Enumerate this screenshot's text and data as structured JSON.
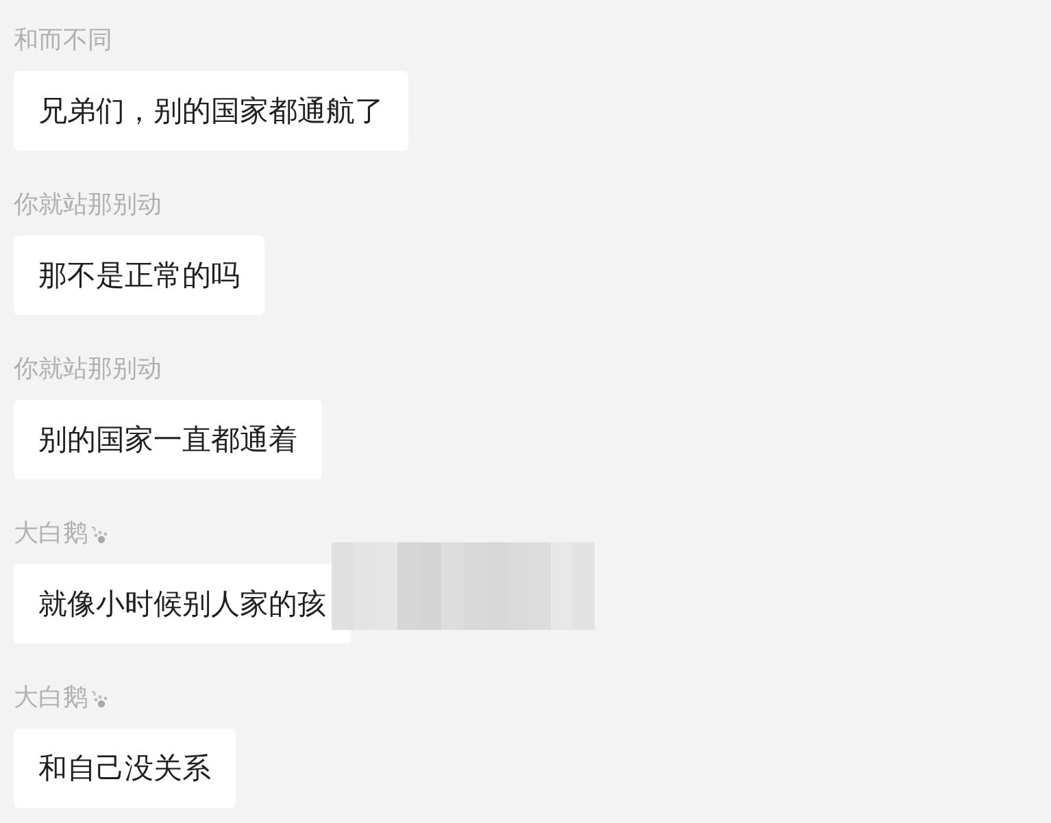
{
  "messages": [
    {
      "sender": "和而不同",
      "sender_badge": false,
      "text": "兄弟们，别的国家都通航了",
      "obscured": false
    },
    {
      "sender": "你就站那别动",
      "sender_badge": false,
      "text": "那不是正常的吗",
      "obscured": false
    },
    {
      "sender": "你就站那别动",
      "sender_badge": false,
      "text": "别的国家一直都通着",
      "obscured": false
    },
    {
      "sender": "大白鹅",
      "sender_badge": true,
      "text": "就像小时候别人家的孩",
      "obscured": true
    },
    {
      "sender": "大白鹅",
      "sender_badge": true,
      "text": "和自己没关系",
      "obscured": false
    }
  ]
}
